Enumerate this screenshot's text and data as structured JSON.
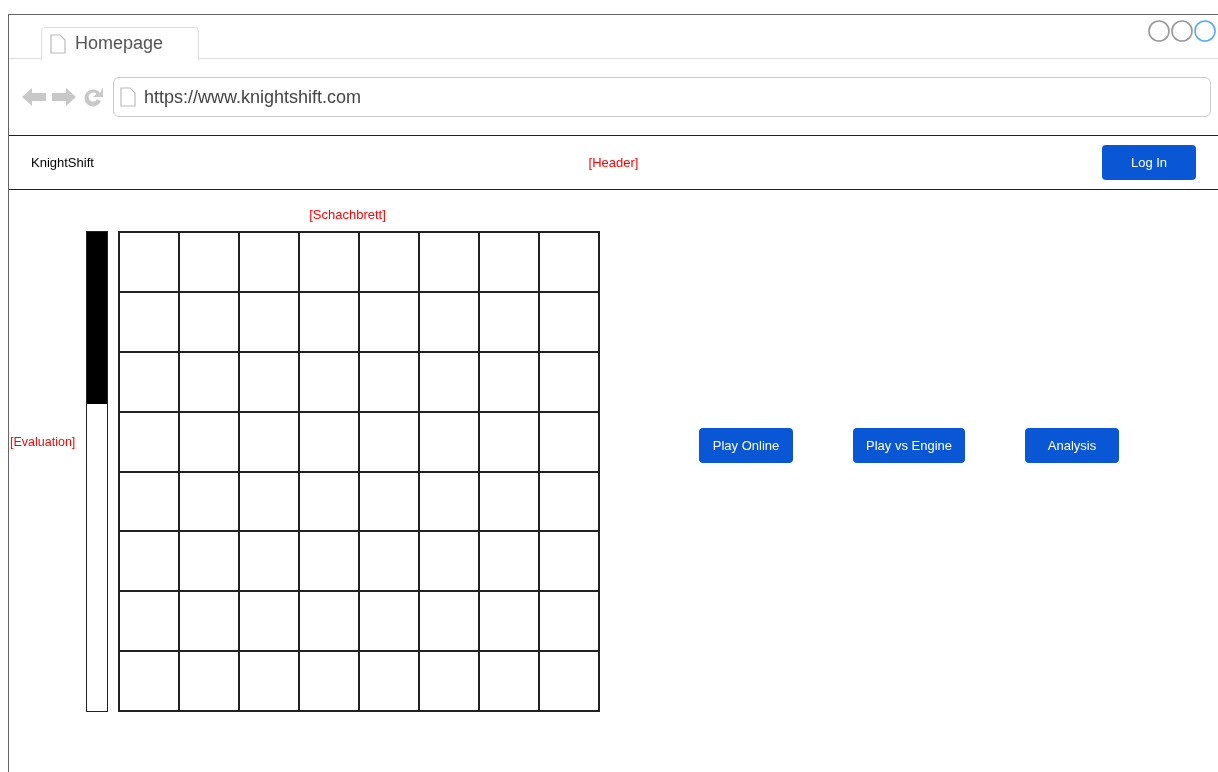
{
  "browser": {
    "tabs": [
      {
        "label": "Homepage",
        "selected": true
      }
    ],
    "address": "https://www.knightshift.com"
  },
  "header": {
    "brand": "KnightShift",
    "annotation": "[Header]",
    "login_button": "Log In"
  },
  "board": {
    "annotation": "[Schachbrett]"
  },
  "evaluation": {
    "annotation": "[Evaluation]",
    "level": 0.36
  },
  "actions": [
    "Play Online",
    "Play vs Engine",
    "Analysis"
  ]
}
